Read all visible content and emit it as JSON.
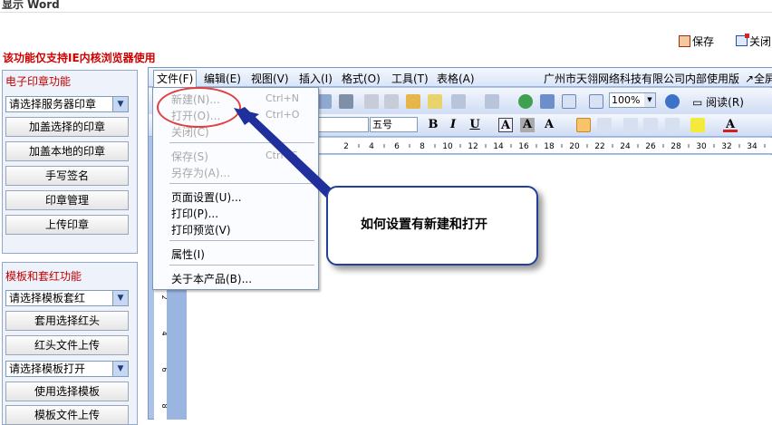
{
  "window": {
    "title": "显示 Word"
  },
  "topbar": {
    "save_label": "保存",
    "close_label": "关闭"
  },
  "warning": "该功能仅支持IE内核浏览器使用",
  "seal_panel": {
    "title": "电子印章功能",
    "select_value": "请选择服务器印章",
    "buttons": [
      "加盖选择的印章",
      "加盖本地的印章",
      "手写签名",
      "印章管理",
      "上传印章"
    ]
  },
  "template_panel": {
    "title": "模板和套红功能",
    "redhead_select": "请选择模板套红",
    "apply_redhead": "套用选择红头",
    "upload_redhead": "红头文件上传",
    "template_select": "请选择模板打开",
    "use_template": "使用选择模板",
    "upload_template": "模板文件上传"
  },
  "menubar": {
    "items": [
      "文件(F)",
      "编辑(E)",
      "视图(V)",
      "插入(I)",
      "格式(O)",
      "工具(T)",
      "表格(A)"
    ],
    "company": "广州市天翎网络科技有限公司内部使用版",
    "fullscreen": "↗全屏"
  },
  "toolbar": {
    "zoom": "100%",
    "read_label": "阅读(R)",
    "font_size": "五号",
    "font_color_label": "A"
  },
  "ruler": {
    "ticks": [
      "2",
      "4",
      "6",
      "8",
      "10",
      "12",
      "14",
      "16",
      "18",
      "20",
      "22",
      "24",
      "26",
      "28",
      "30",
      "32",
      "34",
      "36"
    ]
  },
  "vruler": {
    "ticks": [
      "2",
      "4",
      "6",
      "8"
    ]
  },
  "file_menu": {
    "new": {
      "label": "新建(N)...",
      "shortcut": "Ctrl+N"
    },
    "open": {
      "label": "打开(O)...",
      "shortcut": "Ctrl+O"
    },
    "close": {
      "label": "关闭(C)"
    },
    "save": {
      "label": "保存(S)",
      "shortcut": "Ctrl+S"
    },
    "save_as": {
      "label": "另存为(A)..."
    },
    "page_setup": {
      "label": "页面设置(U)..."
    },
    "print": {
      "label": "打印(P)..."
    },
    "print_preview": {
      "label": "打印预览(V)"
    },
    "properties": {
      "label": "属性(I)"
    },
    "about": {
      "label": "关于本产品(B)..."
    }
  },
  "annotation": {
    "text": "如何设置有新建和打开",
    "colors": {
      "ellipse": "#e04040",
      "arrow": "#1f2f9c"
    }
  }
}
